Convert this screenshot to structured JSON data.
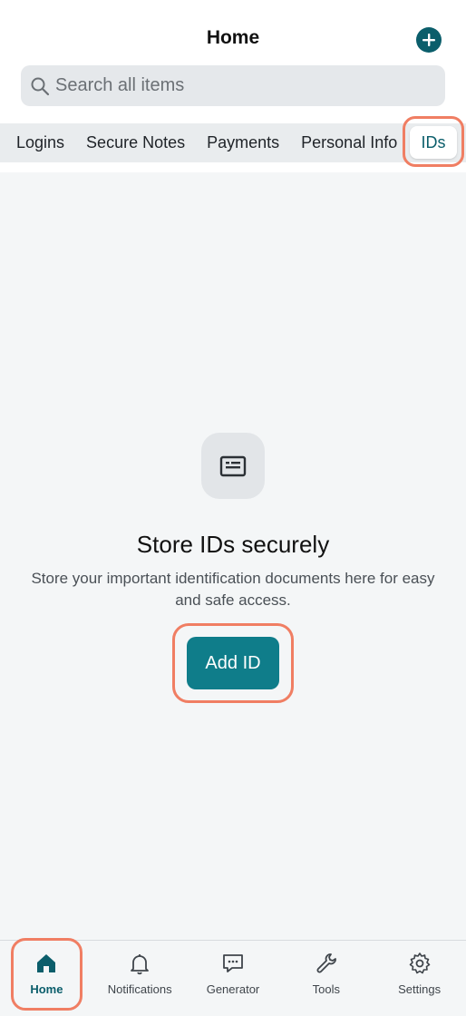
{
  "header": {
    "title": "Home",
    "add_icon": "plus-icon"
  },
  "search": {
    "placeholder": "Search all items",
    "icon": "search-icon"
  },
  "tabs": [
    {
      "label": "Logins"
    },
    {
      "label": "Secure Notes"
    },
    {
      "label": "Payments"
    },
    {
      "label": "Personal Info"
    },
    {
      "label": "IDs",
      "active": true
    }
  ],
  "empty_state": {
    "icon": "id-card-icon",
    "title": "Store IDs securely",
    "description": "Store your important identification documents here for easy and safe access.",
    "button_label": "Add ID"
  },
  "bottom_nav": [
    {
      "label": "Home",
      "icon": "home-icon",
      "active": true
    },
    {
      "label": "Notifications",
      "icon": "bell-icon"
    },
    {
      "label": "Generator",
      "icon": "chat-generator-icon"
    },
    {
      "label": "Tools",
      "icon": "wrench-icon"
    },
    {
      "label": "Settings",
      "icon": "gear-icon"
    }
  ],
  "colors": {
    "accent": "#0b5e6b",
    "button": "#0f7d8a",
    "highlight": "#f07e63",
    "background": "#f4f6f7"
  }
}
